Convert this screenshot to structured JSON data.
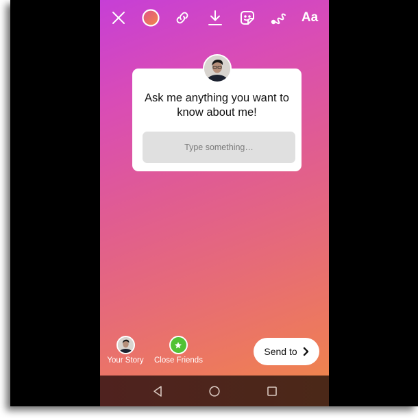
{
  "toolbar": {
    "items": [
      {
        "name": "close",
        "icon": "close-icon"
      },
      {
        "name": "color",
        "icon": "color-circle-icon"
      },
      {
        "name": "link",
        "icon": "link-icon"
      },
      {
        "name": "download",
        "icon": "download-icon"
      },
      {
        "name": "sticker",
        "icon": "sticker-icon"
      },
      {
        "name": "draw",
        "icon": "squiggle-draw-icon"
      },
      {
        "name": "text",
        "icon": "text-icon",
        "label": "Aa"
      }
    ]
  },
  "question_sticker": {
    "prompt": "Ask me anything you want to know about me!",
    "input_placeholder": "Type something…",
    "input_value": ""
  },
  "share": {
    "your_story_label": "Your Story",
    "close_friends_label": "Close Friends",
    "send_label": "Send to"
  },
  "colors": {
    "gradient_start": "#c63fd6",
    "gradient_end": "#f08a45",
    "close_friends_green": "#52c234",
    "input_bg": "#e0e0e0"
  }
}
